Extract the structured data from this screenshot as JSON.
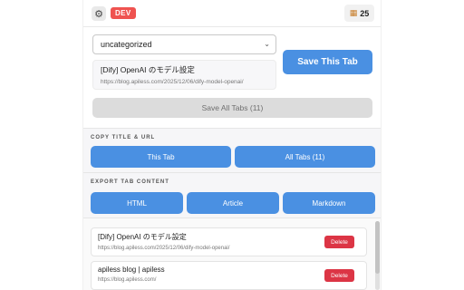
{
  "header": {
    "settings_icon": "gear-icon",
    "badge": "DEV",
    "calendar_icon": "calendar-icon",
    "tab_count": "25"
  },
  "save": {
    "category_selected": "uncategorized",
    "current_tab": {
      "title": "[Dify] OpenAI のモデル設定",
      "url": "https://blog.apiless.com/2025/12/06/dify-model-openai/"
    },
    "save_this_label": "Save This Tab",
    "save_all_label": "Save All Tabs (11)"
  },
  "copy": {
    "section_title": "COPY TITLE & URL",
    "this_tab_label": "This Tab",
    "all_tabs_label": "All Tabs (11)"
  },
  "export": {
    "section_title": "EXPORT TAB CONTENT",
    "html_label": "HTML",
    "article_label": "Article",
    "markdown_label": "Markdown"
  },
  "saved_tabs": [
    {
      "title": "[Dify] OpenAI のモデル設定",
      "url": "https://blog.apiless.com/2025/12/06/dify-model-openai/",
      "delete_label": "Delete"
    },
    {
      "title": "apiless blog | apiless",
      "url": "https://blog.apiless.com/",
      "delete_label": "Delete"
    }
  ],
  "colors": {
    "primary": "#4a90e2",
    "danger": "#dc3545",
    "dev_badge": "#ef5350"
  }
}
